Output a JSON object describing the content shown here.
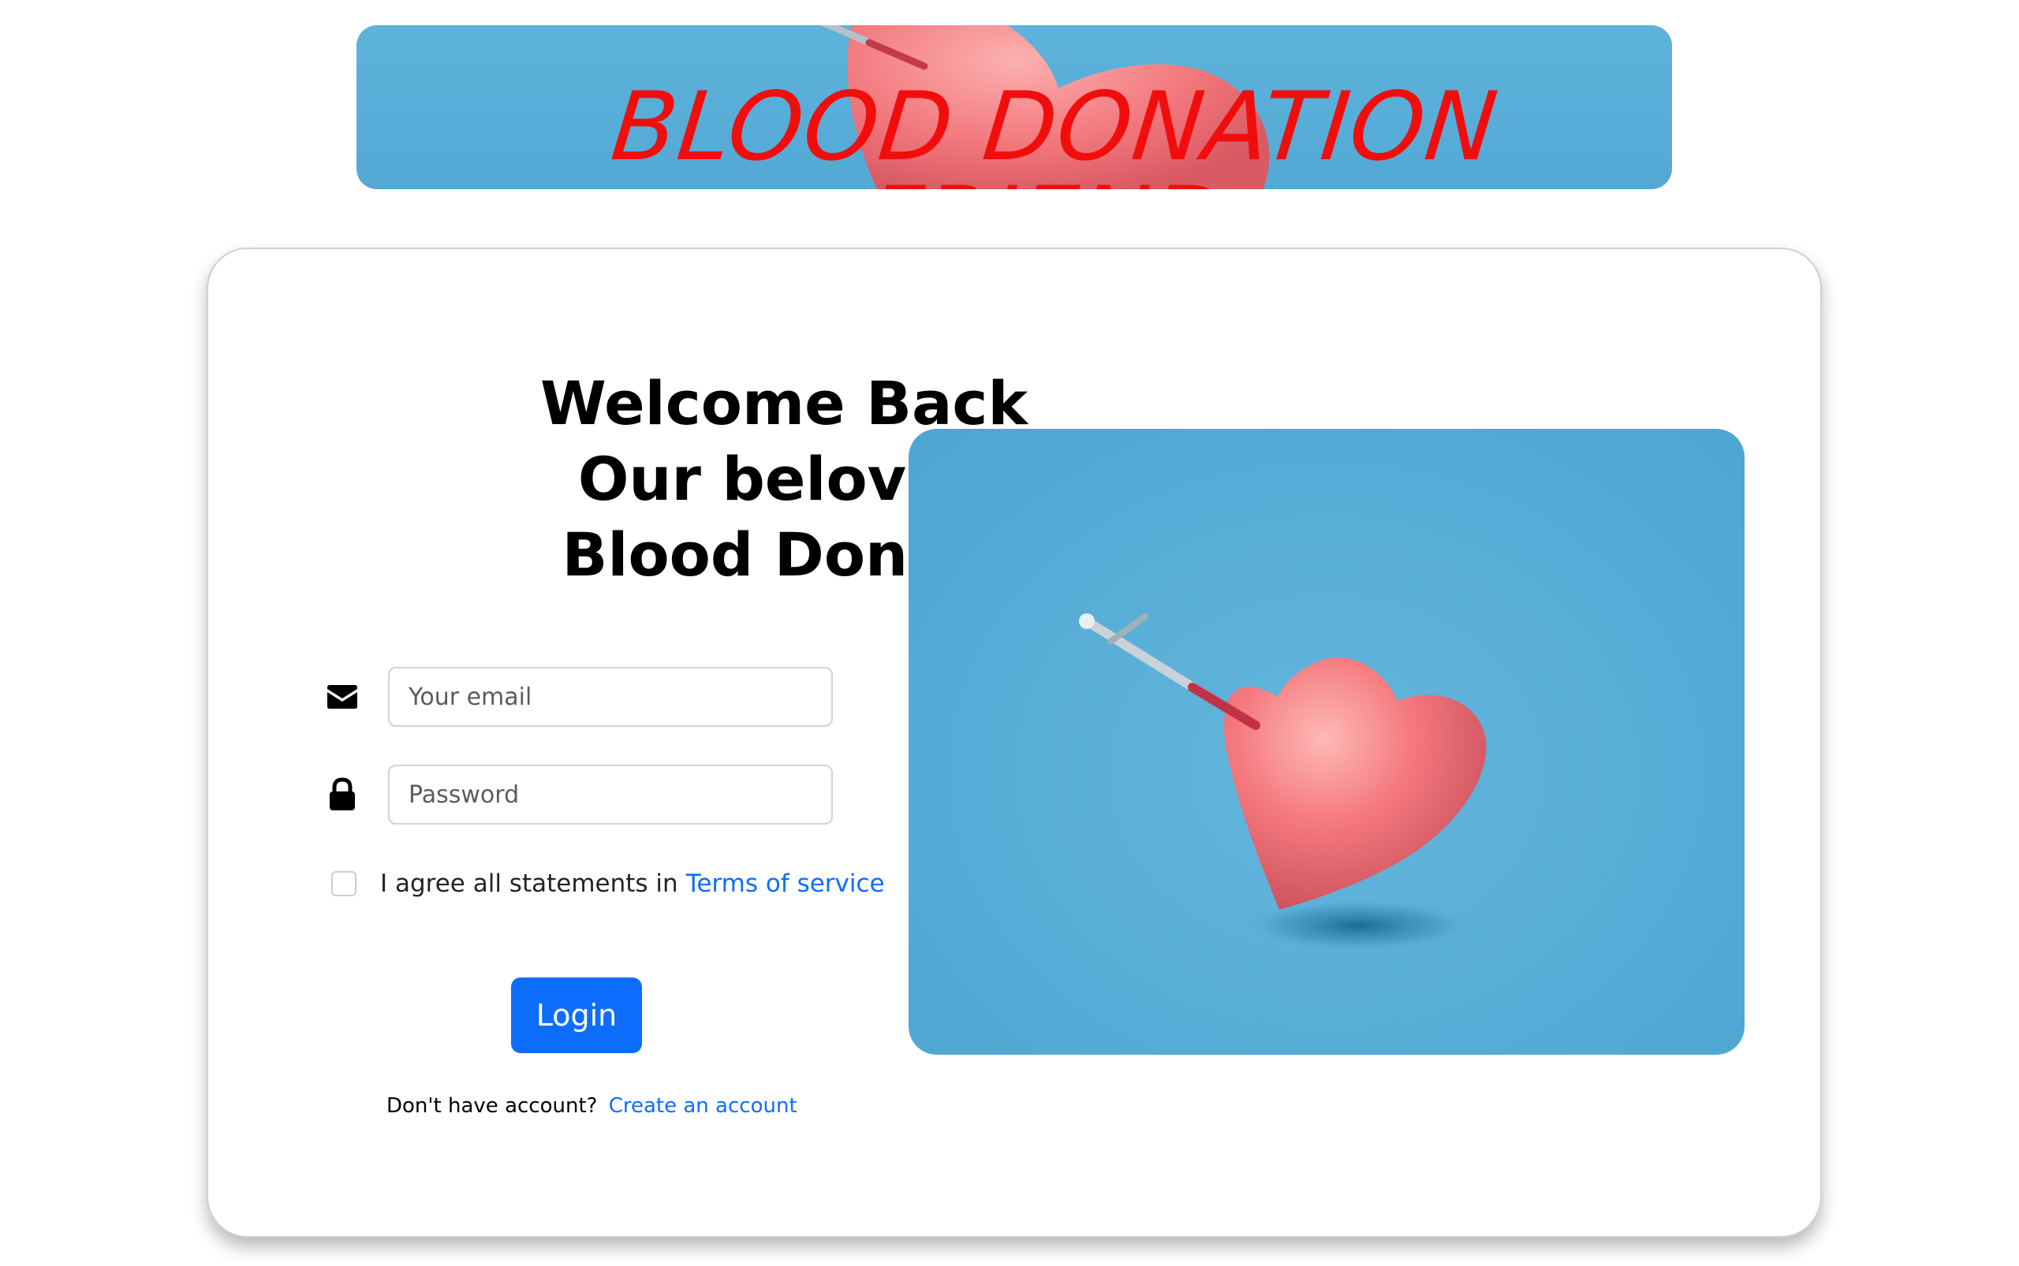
{
  "banner": {
    "title": "BLOOD DONATION FRIEND"
  },
  "login": {
    "heading_lines": [
      "Welcome Back",
      "Our beloved",
      "Blood Donor!"
    ],
    "email": {
      "placeholder": "Your email",
      "value": "",
      "icon": "envelope-icon"
    },
    "password": {
      "placeholder": "Password",
      "value": "",
      "icon": "lock-icon"
    },
    "terms": {
      "text": "I agree all statements in",
      "link_text": "Terms of service",
      "checked": false
    },
    "login_button": "Login",
    "signup": {
      "prompt": "Don't have account?",
      "link_text": "Create an account"
    }
  },
  "colors": {
    "accent": "#0d6efd",
    "banner_title": "#f20d0d",
    "image_background": "#56acd6",
    "heart": "#f4777b"
  }
}
